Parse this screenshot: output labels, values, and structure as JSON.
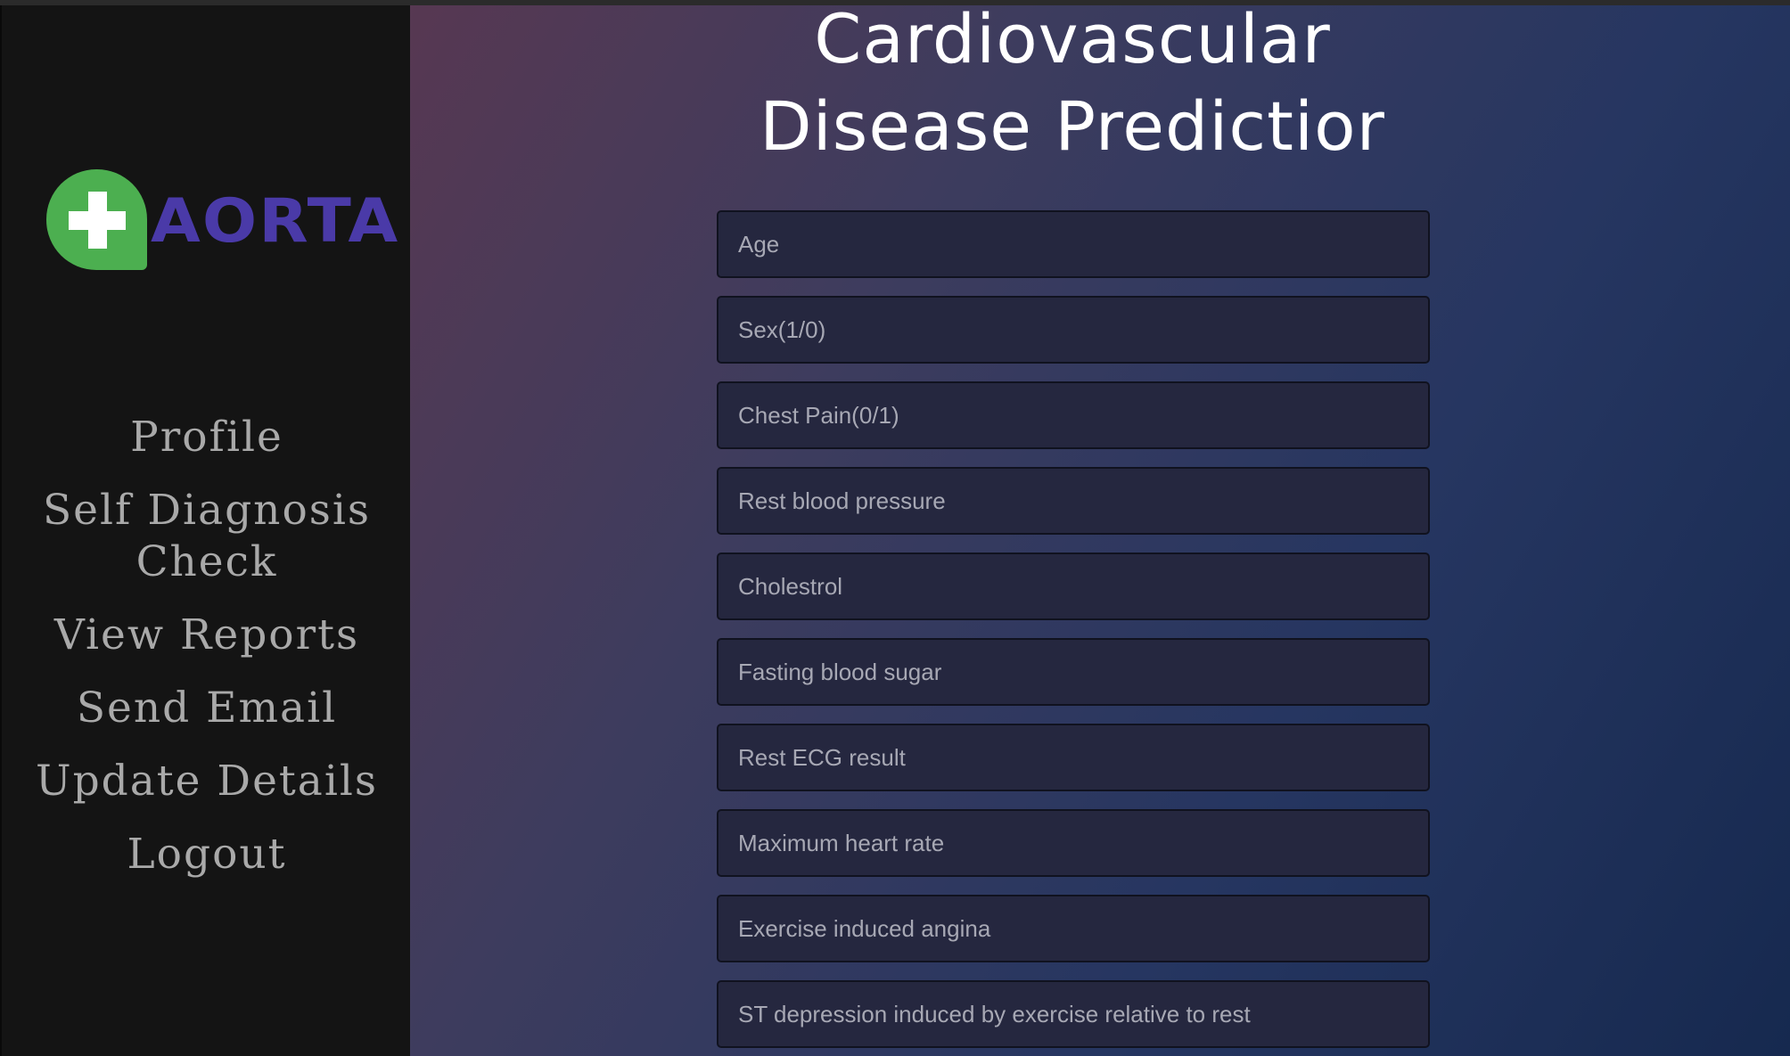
{
  "sidebar": {
    "logo": {
      "text": "AORTA",
      "badge_color": "#4caf50",
      "text_color": "#4a3aa8"
    },
    "nav": [
      {
        "label": "Profile"
      },
      {
        "label": "Self Diagnosis Check"
      },
      {
        "label": "View Reports"
      },
      {
        "label": "Send Email"
      },
      {
        "label": "Update Details"
      },
      {
        "label": "Logout"
      }
    ]
  },
  "main": {
    "title_line1": "Cardiovascular",
    "title_line2": "Disease Predictior",
    "fields": [
      {
        "placeholder": "Age",
        "value": ""
      },
      {
        "placeholder": "Sex(1/0)",
        "value": ""
      },
      {
        "placeholder": "Chest Pain(0/1)",
        "value": ""
      },
      {
        "placeholder": "Rest blood pressure",
        "value": ""
      },
      {
        "placeholder": "Cholestrol",
        "value": ""
      },
      {
        "placeholder": "Fasting blood sugar",
        "value": ""
      },
      {
        "placeholder": "Rest ECG result",
        "value": ""
      },
      {
        "placeholder": "Maximum heart rate",
        "value": ""
      },
      {
        "placeholder": "Exercise induced angina",
        "value": ""
      },
      {
        "placeholder": "ST depression induced by exercise relative to rest",
        "value": ""
      }
    ]
  },
  "colors": {
    "sidebar_bg": "#141414",
    "nav_text": "#a9a9a9",
    "field_bg": "#25273f",
    "title_text": "#ffffff"
  }
}
